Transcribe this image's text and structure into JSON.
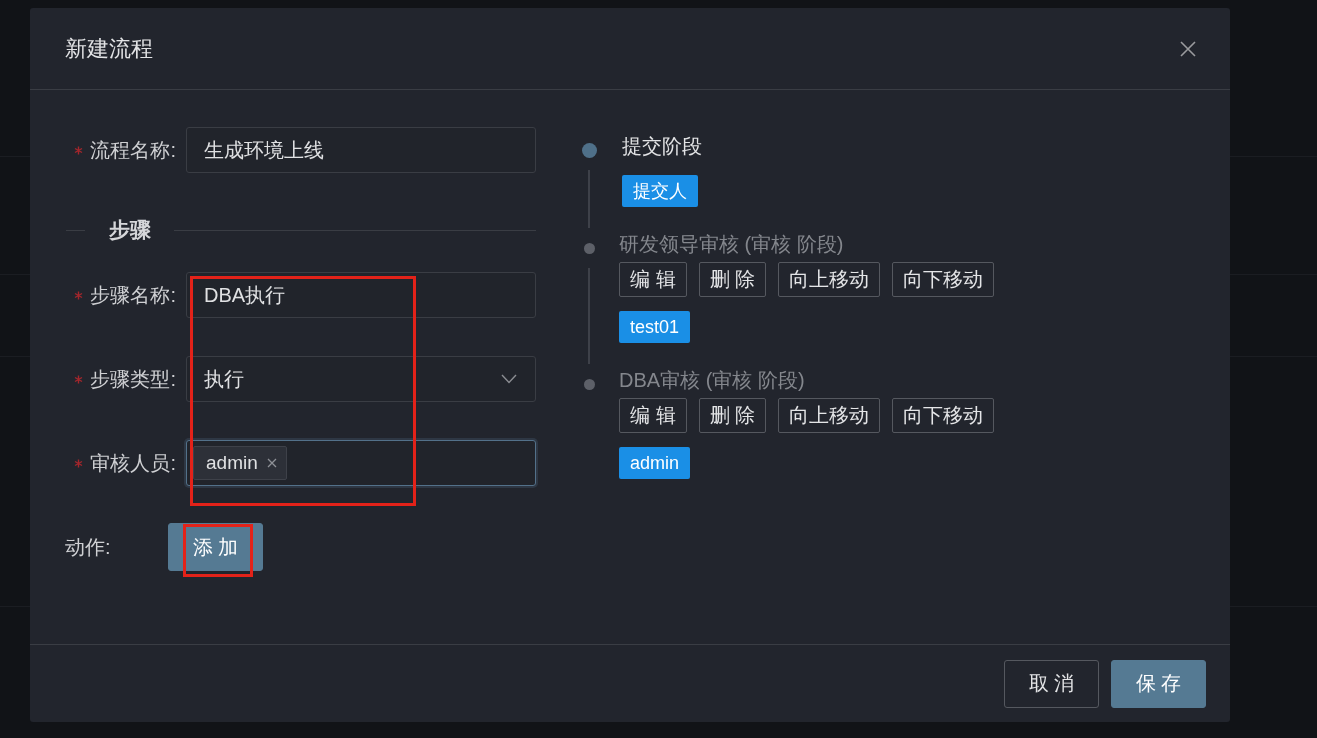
{
  "dialog": {
    "title": "新建流程"
  },
  "form": {
    "fields": [
      {
        "kind": "text",
        "label": "流程名称:",
        "required": true,
        "value": "生成环境上线"
      }
    ],
    "section": {
      "title": "步骤",
      "highlighted": true,
      "fields": [
        {
          "kind": "text",
          "label": "步骤名称:",
          "required": true,
          "value": "DBA执行"
        },
        {
          "kind": "select",
          "label": "步骤类型:",
          "required": true,
          "value": "执行"
        },
        {
          "kind": "tags",
          "label": "审核人员:",
          "required": true,
          "focused": true,
          "tags": [
            "admin"
          ]
        }
      ]
    },
    "action": {
      "label": "动作:",
      "button": "添 加",
      "highlighted": true
    }
  },
  "timeline": [
    {
      "title": "提交阶段",
      "active": true,
      "tags": [
        "提交人"
      ]
    },
    {
      "title": "研发领导审核 (审核 阶段)",
      "active": false,
      "actions": [
        "编 辑",
        "删 除",
        "向上移动",
        "向下移动"
      ],
      "tags": [
        "test01"
      ]
    },
    {
      "title": "DBA审核 (审核 阶段)",
      "active": false,
      "actions": [
        "编 辑",
        "删 除",
        "向上移动",
        "向下移动"
      ],
      "tags": [
        "admin"
      ]
    }
  ],
  "footer": {
    "buttons": [
      {
        "label": "取 消",
        "kind": "default"
      },
      {
        "label": "保 存",
        "kind": "primary"
      }
    ]
  }
}
